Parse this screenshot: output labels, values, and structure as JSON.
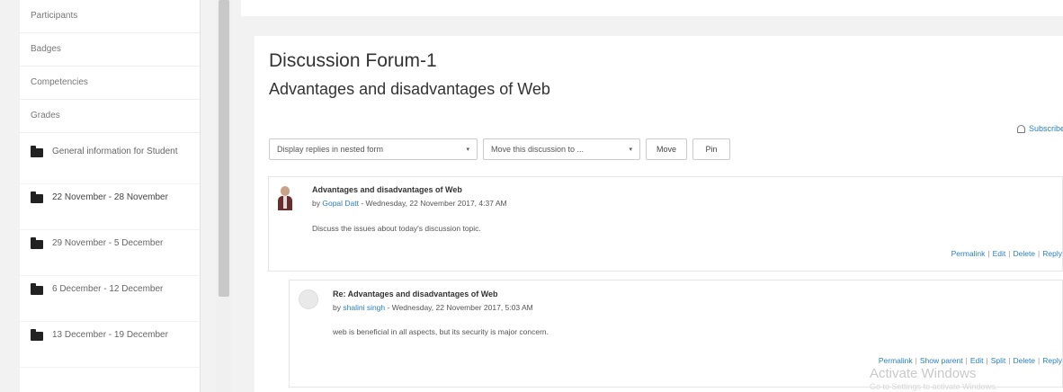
{
  "sidebar": {
    "items": [
      "Participants",
      "Badges",
      "Competencies",
      "Grades"
    ],
    "sections": [
      "General information for Student",
      "22 November - 28 November",
      "29 November - 5 December",
      "6 December - 12 December",
      "13 December - 19 December"
    ]
  },
  "main": {
    "forum_title": "Discussion Forum-1",
    "discussion_title": "Advantages and disadvantages of Web",
    "subscribe": "Subscribe",
    "display_mode": "Display replies in nested form",
    "move_select": "Move this discussion to ...",
    "move_button": "Move",
    "pin_button": "Pin"
  },
  "posts": [
    {
      "subject": "Advantages and disadvantages of Web",
      "by": "by",
      "author": "Gopal Datt",
      "date": " - Wednesday, 22 November 2017, 4:37 AM",
      "message": "Discuss the issues about today's discussion topic.",
      "commands": [
        "Permalink",
        "Edit",
        "Delete",
        "Reply"
      ]
    },
    {
      "subject": "Re: Advantages and disadvantages of Web",
      "by": "by",
      "author": "shalini singh",
      "date": " - Wednesday, 22 November 2017, 5:03 AM",
      "message": "web is beneficial in all aspects, but its security is major concern.",
      "commands": [
        "Permalink",
        "Show parent",
        "Edit",
        "Split",
        "Delete",
        "Reply"
      ]
    }
  ],
  "watermark": {
    "line1": "Activate Windows",
    "line2": "Go to Settings to activate Windows."
  }
}
